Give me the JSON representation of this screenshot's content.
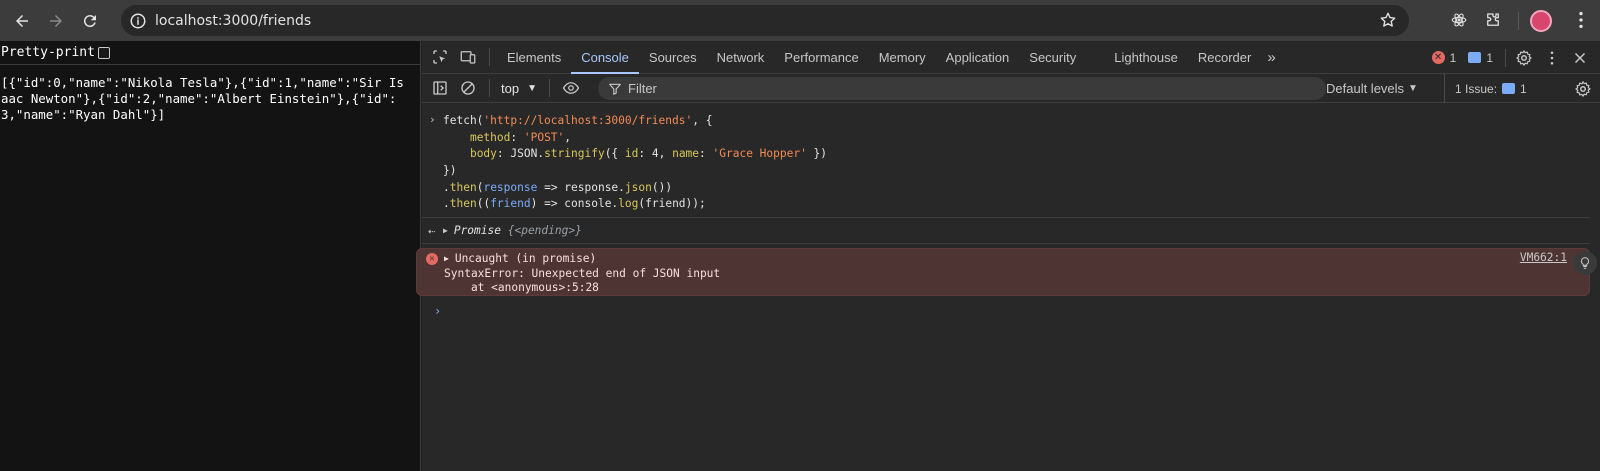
{
  "browser": {
    "url": "localhost:3000/friends"
  },
  "page": {
    "pretty_print_label": "Pretty-print",
    "json_text": "[{\"id\":0,\"name\":\"Nikola Tesla\"},{\"id\":1,\"name\":\"Sir Isaac Newton\"},{\"id\":2,\"name\":\"Albert Einstein\"},{\"id\":3,\"name\":\"Ryan Dahl\"}]"
  },
  "devtools": {
    "tabs": [
      "Elements",
      "Console",
      "Sources",
      "Network",
      "Performance",
      "Memory",
      "Application",
      "Security",
      "Lighthouse",
      "Recorder"
    ],
    "active_tab": "Console",
    "overflow_glyph": "»",
    "error_count": "1",
    "message_count": "1",
    "console_toolbar": {
      "context": "top",
      "filter_placeholder": "Filter",
      "levels_label": "Default levels",
      "issues_label": "1 Issue:",
      "issues_count": "1"
    },
    "console": {
      "promise_label": "Promise",
      "promise_state": "{<pending>}",
      "error": {
        "title": "Uncaught (in promise)",
        "message": "SyntaxError: Unexpected end of JSON input",
        "location": "    at <anonymous>:5:28",
        "source_link": "VM662:1"
      }
    }
  },
  "colors": {
    "accent": "#a8c7fa",
    "error": "#e46962",
    "error_bg": "#4e3534",
    "string": "#f28b54",
    "property": "#d9c75b",
    "variable": "#7cacf8"
  }
}
